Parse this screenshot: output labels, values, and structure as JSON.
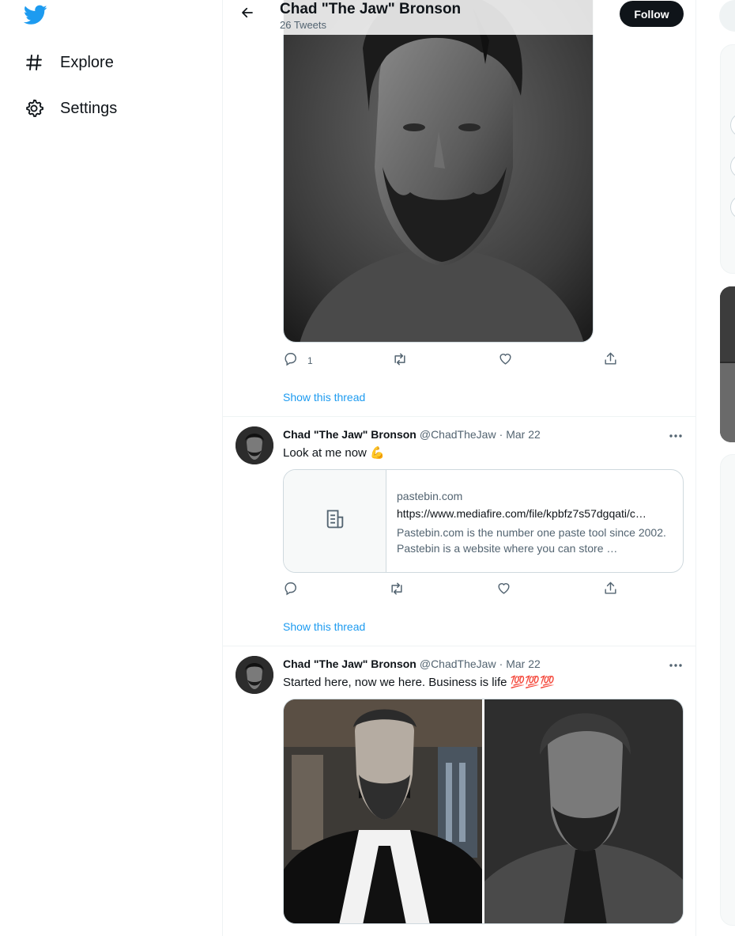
{
  "left_nav": {
    "logo_icon": "twitter-bird-icon",
    "items": [
      {
        "label": "Explore",
        "icon": "hashtag-icon"
      },
      {
        "label": "Settings",
        "icon": "gear-icon"
      }
    ]
  },
  "header": {
    "title": "Chad \"The Jaw\" Bronson",
    "subtitle": "26 Tweets",
    "follow_label": "Follow",
    "back_icon": "arrow-left-icon"
  },
  "tweets": [
    {
      "media": "portrait photo",
      "actions": {
        "reply_count": "1",
        "retweet_count": "",
        "like_count": ""
      },
      "show_thread": "Show this thread"
    },
    {
      "name": "Chad \"The Jaw\" Bronson",
      "handle": "@ChadTheJaw",
      "separator": "·",
      "date": "Mar 22",
      "text": "Look at me now 💪",
      "card": {
        "domain": "pastebin.com",
        "title": "https://www.mediafire.com/file/kpbfz7s57dgqati/c…",
        "description": "Pastebin.com is the number one paste tool since 2002. Pastebin is a website where you can store …"
      },
      "show_thread": "Show this thread"
    },
    {
      "name": "Chad \"The Jaw\" Bronson",
      "handle": "@ChadTheJaw",
      "separator": "·",
      "date": "Mar 22",
      "text": "Started here, now we here. Business is life 💯💯💯"
    }
  ],
  "colors": {
    "brand": "#1d9bf0",
    "text": "#0f1419",
    "muted": "#536471",
    "border": "#cfd9de"
  }
}
